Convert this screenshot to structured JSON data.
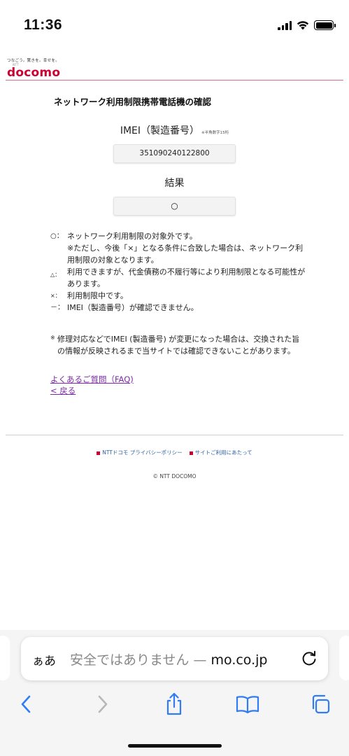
{
  "status_bar": {
    "time": "11:36"
  },
  "brand": {
    "tagline": "つなごう。驚きを。幸せを。",
    "ntt": "NTT",
    "logo": "docomo",
    "color": "#cc0033"
  },
  "page": {
    "title": "ネットワーク利用制限携帯電話機の確認",
    "imei_label": "IMEI（製造番号）",
    "imei_note": "※半角数字15桁",
    "imei_value": "351090240122800",
    "result_label": "結果",
    "result_value": "○"
  },
  "legend": [
    {
      "symbol": "○：",
      "text": "ネットワーク利用制限の対象外です。"
    },
    {
      "symbol": "",
      "text": "※ただし、今後「×」となる条件に合致した場合は、ネットワーク利用制限の対象となります。"
    },
    {
      "symbol": "△：",
      "text": "利用できますが、代金債務の不履行等により利用制限となる可能性があります。"
    },
    {
      "symbol": "×：",
      "text": "利用制限中です。"
    },
    {
      "symbol": "－：",
      "text": "IMEI（製造番号）が確認できません。"
    }
  ],
  "note": {
    "mark": "※",
    "text": "修理対応などでIMEI (製造番号) が変更になった場合は、交換された旨の情報が反映されるまで当サイトでは確認できないことがあります。"
  },
  "links": {
    "faq": "よくあるご質問（FAQ)",
    "back": "< 戻る"
  },
  "footer": {
    "privacy": "NTTドコモ プライバシーポリシー",
    "terms": "サイトご利用にあたって",
    "copyright": "© NTT DOCOMO"
  },
  "browser": {
    "aa_label": "ぁあ",
    "url_prefix": "安全ではありません — ",
    "url_domain": "mo.co.jp"
  },
  "colors": {
    "link": "#7a2aa8",
    "footer_link": "#2d5fa8",
    "header_line": "#d66e92"
  }
}
